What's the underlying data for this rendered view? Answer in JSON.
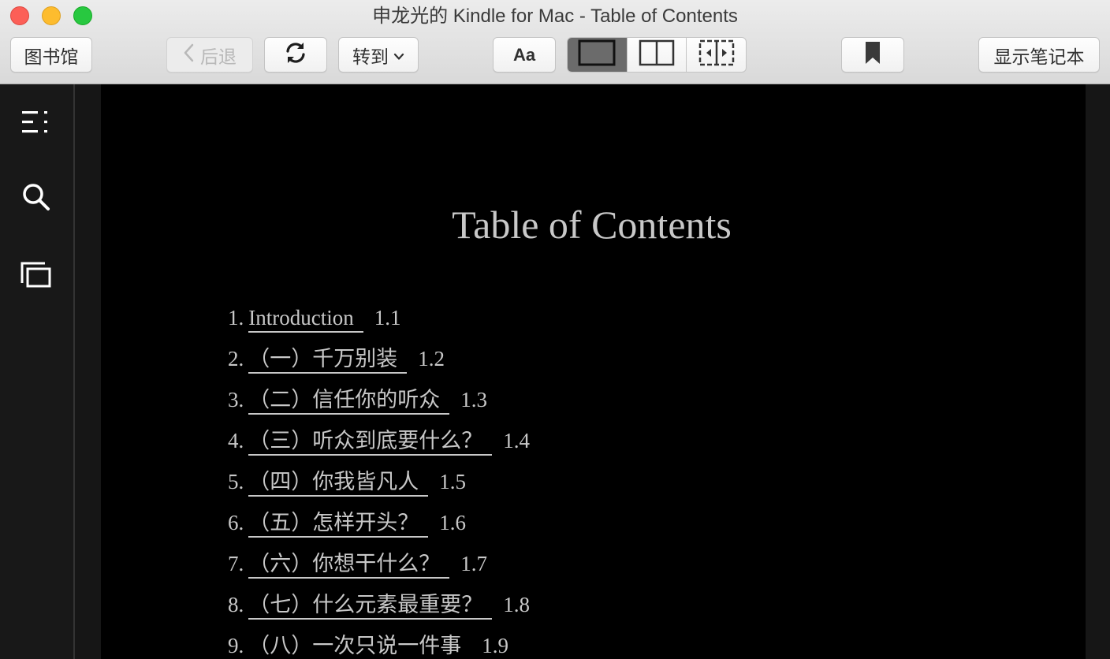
{
  "window": {
    "title": "申龙光的 Kindle for Mac - Table of Contents"
  },
  "toolbar": {
    "library_label": "图书馆",
    "back_label": "后退",
    "goto_label": "转到",
    "font_label": "Aa",
    "notes_label": "显示笔记本",
    "icons": {
      "back": "chevron-left-icon",
      "sync": "sync-icon",
      "goto": "chevron-down-icon",
      "single_page": "single-page-view-icon",
      "two_page": "two-page-view-icon",
      "scroll": "scroll-view-icon",
      "bookmark": "bookmark-icon"
    },
    "active_view": "single_page"
  },
  "sidebar": {
    "icons": [
      "toc-icon",
      "search-icon",
      "flashcards-icon"
    ]
  },
  "page": {
    "title": "Table of Contents",
    "toc": [
      {
        "num": "1.",
        "label": "Introduction",
        "loc": "1.1"
      },
      {
        "num": "2.",
        "label": "（一）千万别装",
        "loc": "1.2"
      },
      {
        "num": "3.",
        "label": "（二）信任你的听众",
        "loc": "1.3"
      },
      {
        "num": "4.",
        "label": "（三）听众到底要什么？",
        "loc": "1.4"
      },
      {
        "num": "5.",
        "label": "（四）你我皆凡人",
        "loc": "1.5"
      },
      {
        "num": "6.",
        "label": "（五）怎样开头？",
        "loc": "1.6"
      },
      {
        "num": "7.",
        "label": "（六）你想干什么？",
        "loc": "1.7"
      },
      {
        "num": "8.",
        "label": "（七）什么元素最重要？",
        "loc": "1.8"
      },
      {
        "num": "9.",
        "label": "（八）一次只说一件事",
        "loc": "1.9"
      }
    ]
  },
  "colors": {
    "page_background": "#000000",
    "page_text": "#c8c8c8",
    "sidebar_background": "#181818",
    "toolbar_background": "#e4e4e4",
    "active_segment": "#6b6b6b"
  }
}
